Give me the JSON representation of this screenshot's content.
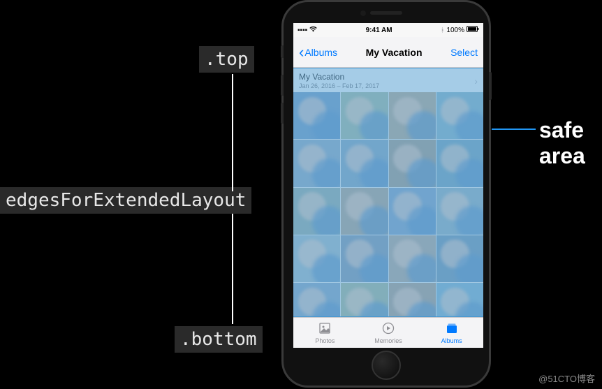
{
  "labels": {
    "top": ".top",
    "bottom": ".bottom",
    "edges": "edgesForExtendedLayout",
    "safe_area": "safe area"
  },
  "status_bar": {
    "signal": "▪▪▪▪",
    "wifi": "✦",
    "time": "9:41 AM",
    "bluetooth": "ᚼ",
    "battery_pct": "100%",
    "battery_icon": "▮"
  },
  "nav": {
    "back_chevron": "‹",
    "back_label": "Albums",
    "title": "My Vacation",
    "action": "Select"
  },
  "section": {
    "title": "My Vacation",
    "subtitle": "Jan 26, 2016 – Feb 17, 2017",
    "chevron": "›"
  },
  "tabs": [
    {
      "key": "photos",
      "label": "Photos",
      "active": false
    },
    {
      "key": "memories",
      "label": "Memories",
      "active": false
    },
    {
      "key": "albums",
      "label": "Albums",
      "active": true
    }
  ],
  "watermark": "@51CTO博客",
  "colors": {
    "ios_blue": "#007aff",
    "overlay_blue": "#4096d2"
  }
}
